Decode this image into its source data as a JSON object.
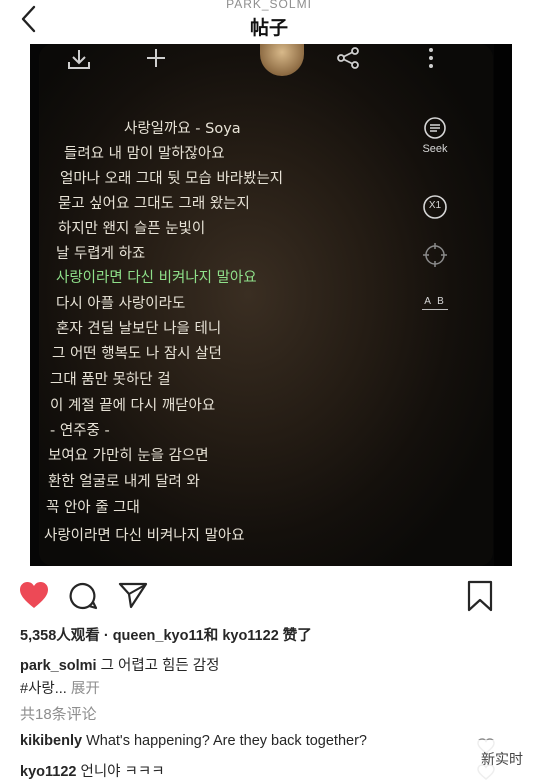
{
  "header": {
    "owner": "PARK_SOLMI",
    "title": "帖子"
  },
  "photo": {
    "lyrics": [
      {
        "text": "사랑일까요 - Soya",
        "highlight": false
      },
      {
        "text": "들려요 내 맘이 말하잖아요",
        "highlight": false
      },
      {
        "text": "얼마나 오래 그대 뒷 모습 바라봤는지",
        "highlight": false
      },
      {
        "text": "묻고 싶어요 그대도 그래 왔는지",
        "highlight": false
      },
      {
        "text": "하지만 왠지 슬픈 눈빛이",
        "highlight": false
      },
      {
        "text": "날 두렵게 하죠",
        "highlight": false
      },
      {
        "text": "사랑이라면 다신 비켜나지 말아요",
        "highlight": true
      },
      {
        "text": "다시 아플 사랑이라도",
        "highlight": false
      },
      {
        "text": "혼자 견딜 날보단 나을 테니",
        "highlight": false
      },
      {
        "text": "그 어떤 행복도 나 잠시 살던",
        "highlight": false
      },
      {
        "text": "그대 품만 못하단 걸",
        "highlight": false
      },
      {
        "text": "이 계절 끝에 다시 깨닫아요",
        "highlight": false
      },
      {
        "text": "- 연주중 -",
        "highlight": false
      },
      {
        "text": "보여요 가만히 눈을 감으면",
        "highlight": false
      },
      {
        "text": "환한 얼굴로 내게 달려 와",
        "highlight": false
      },
      {
        "text": "꼭 안아 줄 그대",
        "highlight": false
      },
      {
        "text": "사랑이라면 다신 비켜나지 말아요",
        "highlight": false
      }
    ],
    "side_tools": {
      "seek": "Seek",
      "speed": "X1",
      "ab": "A B"
    }
  },
  "stats": {
    "views": "5,358人观看",
    "separator": "·",
    "liked_by_1": "queen_kyo11",
    "liked_and": "和",
    "liked_by_2": "kyo1122",
    "liked_suffix": "赞了"
  },
  "caption": {
    "username": "park_solmi",
    "text": "그 어렵고 힘든 감정",
    "hashtag": "#사랑...",
    "more": "展开"
  },
  "comments_count": "共18条评论",
  "comments": [
    {
      "user": "kikibenly",
      "text": "What's happening?  Are they back together?"
    },
    {
      "user": "kyo1122",
      "text": "언니야 ㅋㅋㅋ"
    }
  ],
  "watermark": "新实时",
  "colors": {
    "like_red": "#ed4956",
    "text": "#262626",
    "muted": "#8e8e8e",
    "lyric_highlight": "#8fe08a"
  }
}
